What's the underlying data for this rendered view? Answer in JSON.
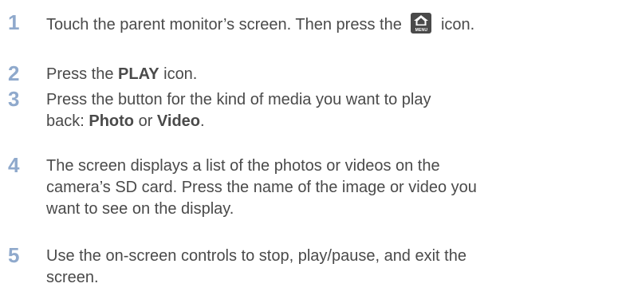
{
  "steps": [
    {
      "number": "1",
      "text_before": "Touch the parent monitor’s screen. Then press the",
      "icon_label": "MENU",
      "text_after": "icon."
    },
    {
      "number": "2",
      "text_before": "Press the ",
      "bold": "PLAY",
      "text_after": " icon."
    },
    {
      "number": "3",
      "line1": "Press the button for the kind of media you want to play",
      "text_before": "back: ",
      "bold1": "Photo",
      "middle": " or ",
      "bold2": "Video",
      "text_after": "."
    },
    {
      "number": "4",
      "line1": "The screen displays a list of the photos or videos on the",
      "line2": "camera’s SD card. Press the name of the image or video you",
      "line3": "want to see on the display."
    },
    {
      "number": "5",
      "line1": "Use the on-screen controls to stop, play/pause, and exit the",
      "line2": "screen."
    }
  ],
  "colors": {
    "number": "#8fa9cc",
    "text": "#4a4a4a",
    "icon_background": "#4a4a4a"
  }
}
